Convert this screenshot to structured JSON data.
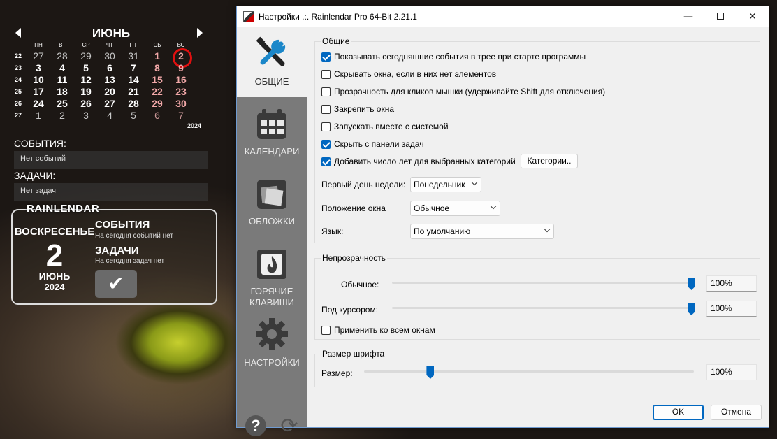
{
  "calendar": {
    "month": "ИЮНЬ",
    "year": "2024",
    "weekdays": [
      "ПН",
      "ВТ",
      "СР",
      "ЧТ",
      "ПТ",
      "СБ",
      "ВС"
    ],
    "weeks": [
      {
        "wk": "22",
        "days": [
          "27",
          "28",
          "29",
          "30",
          "31",
          "1",
          "2"
        ]
      },
      {
        "wk": "23",
        "days": [
          "3",
          "4",
          "5",
          "6",
          "7",
          "8",
          "9"
        ]
      },
      {
        "wk": "24",
        "days": [
          "10",
          "11",
          "12",
          "13",
          "14",
          "15",
          "16"
        ]
      },
      {
        "wk": "25",
        "days": [
          "17",
          "18",
          "19",
          "20",
          "21",
          "22",
          "23"
        ]
      },
      {
        "wk": "26",
        "days": [
          "24",
          "25",
          "26",
          "27",
          "28",
          "29",
          "30"
        ]
      },
      {
        "wk": "27",
        "days": [
          "1",
          "2",
          "3",
          "4",
          "5",
          "6",
          "7"
        ]
      }
    ]
  },
  "events_panel": {
    "title": "СОБЫТИЯ:",
    "text": "Нет событий"
  },
  "tasks_panel": {
    "title": "ЗАДАЧИ:",
    "text": "Нет задач"
  },
  "today_box": {
    "title": "RAINLENDAR",
    "weekday": "ВОСКРЕСЕНЬЕ",
    "day": "2",
    "month": "ИЮНЬ",
    "year": "2024",
    "events_heading": "СОБЫТИЯ",
    "events_text": "На сегодня событий нет",
    "tasks_heading": "ЗАДАЧИ",
    "tasks_text": "На сегодня задач нет",
    "check_icon": "checkmark-icon"
  },
  "window": {
    "title": "Настройки .:. Rainlendar Pro 64-Bit 2.21.1",
    "min_glyph": "—",
    "close_glyph": "✕"
  },
  "sidebar": {
    "items": [
      {
        "label": "ОБЩИЕ",
        "icon": "tools-icon"
      },
      {
        "label": "КАЛЕНДАРИ",
        "icon": "calendar-icon"
      },
      {
        "label": "ОБЛОЖКИ",
        "icon": "skins-icon"
      },
      {
        "label1": "ГОРЯЧИЕ",
        "label2": "КЛАВИШИ",
        "icon": "hotkeys-icon"
      },
      {
        "label": "НАСТРОЙКИ",
        "icon": "settings-gear-icon"
      }
    ],
    "help_glyph": "?",
    "update_glyph": "⟳"
  },
  "general": {
    "title": "Общие",
    "checkboxes": [
      {
        "label": "Показывать сегодняшние события в трее при старте программы",
        "checked": true
      },
      {
        "label": "Скрывать окна, если в них нет элементов",
        "checked": false
      },
      {
        "label": "Прозрачность для кликов мышки (удерживайте Shift для отключения)",
        "checked": false
      },
      {
        "label": "Закрепить окна",
        "checked": false
      },
      {
        "label": "Запускать вместе с системой",
        "checked": false
      },
      {
        "label": "Скрыть с панели задач",
        "checked": true
      },
      {
        "label": "Добавить число лет для выбранных категорий",
        "checked": true
      }
    ],
    "categories_button": "Категории..",
    "first_day_label": "Первый день недели:",
    "first_day_value": "Понедельник",
    "position_label": "Положение окна",
    "position_value": "Обычное",
    "language_label": "Язык:",
    "language_value": "По умолчанию"
  },
  "opacity": {
    "title": "Непрозрачность",
    "normal_label": "Обычное:",
    "normal_value": "100%",
    "normal_level": 1.0,
    "hover_label": "Под курсором:",
    "hover_value": "100%",
    "hover_level": 1.0,
    "apply_all_label": "Применить ко всем окнам",
    "apply_all_checked": false
  },
  "font_size": {
    "title": "Размер шрифта",
    "size_label": "Размер:",
    "size_value": "100%",
    "size_level": 0.2
  },
  "footer": {
    "ok": "OK",
    "cancel": "Отмена"
  },
  "colors": {
    "accent": "#0067c0",
    "today_ring": "#e01010",
    "weekend": "#f2a8a8",
    "sidebar_bg": "#7a7a7a"
  }
}
